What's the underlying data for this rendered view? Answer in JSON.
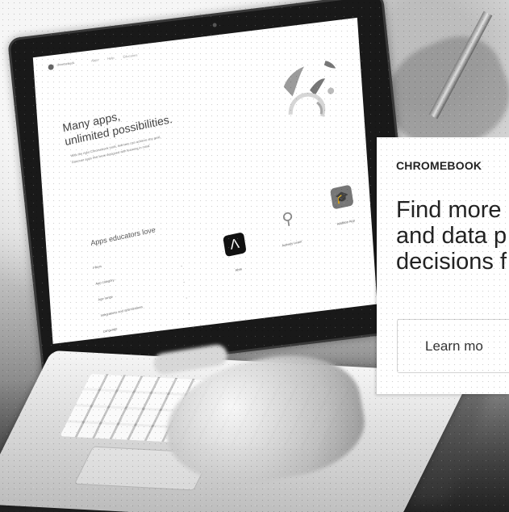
{
  "screen": {
    "brand": "chromebook",
    "nav": [
      "Apps",
      "Help",
      "Educators"
    ],
    "hero": {
      "title_lines": [
        "Many apps,",
        "unlimited possibilities."
      ],
      "body_lines": [
        "With the right Chromebook tools, learners can achieve any goal.",
        "Discover apps that were designed with learning in mind."
      ]
    },
    "section_title": "Apps educators love",
    "filters": [
      {
        "label": "Filters",
        "arrow": ""
      },
      {
        "label": "App category",
        "arrow": "⌄"
      },
      {
        "label": "Age range",
        "arrow": "⌄"
      },
      {
        "label": "Integrations and optimizations",
        "arrow": "⌄"
      },
      {
        "label": "Language",
        "arrow": "⌄"
      }
    ],
    "apps": [
      {
        "name": "Abre",
        "icon": "abre-icon",
        "glyph": "Λ"
      },
      {
        "name": "Actively Learn",
        "icon": "actively-learn-icon",
        "glyph": "⚲"
      },
      {
        "name": "Addition App",
        "icon": "graduation-cap-icon",
        "glyph": "🎓"
      }
    ]
  },
  "promo": {
    "kicker": "CHROMEBOOK",
    "heading_lines": [
      "Find more",
      "and data p",
      "decisions f"
    ],
    "button_label": "Learn mo"
  },
  "colors": {
    "photo_gray": "#d8d8d8",
    "laptop_dark": "#191919",
    "card_white": "#ffffff",
    "text_dark": "#222222"
  }
}
